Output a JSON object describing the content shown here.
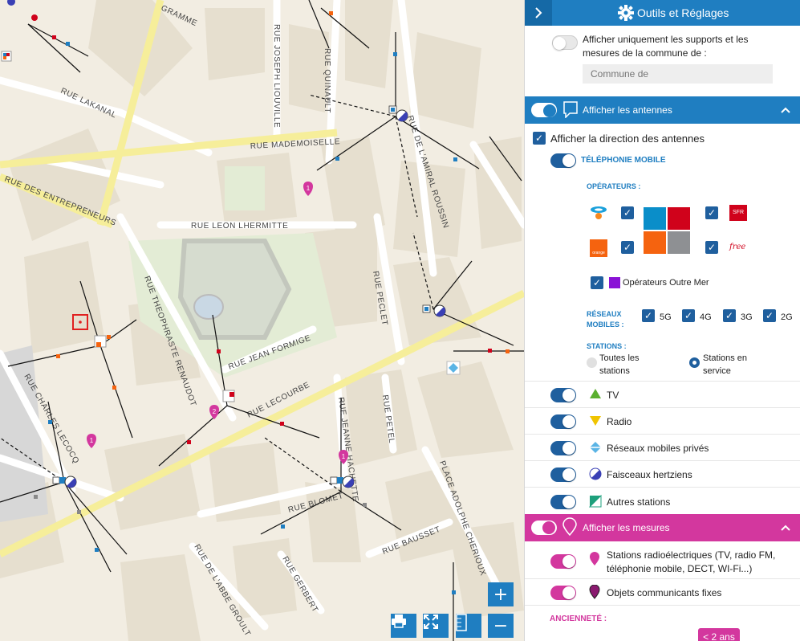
{
  "map": {
    "streets": [
      "RUE LAKANAL",
      "RUE JOSEPH LIOUVILLE",
      "RUE QUINAULT",
      "RUE MADEMOISELLE",
      "RUE DES ENTREPRENEURS",
      "RUE DE L'AMIRAL ROUSSIN",
      "RUE LEON LHERMITTE",
      "RUE THEOPHRASTE RENAUDOT",
      "RUE PECLET",
      "RUE JEAN FORMIGE",
      "RUE CHARLES LECOCQ",
      "RUE LECOURBE",
      "RUE JEANNE HACHETTE",
      "RUE PETEL",
      "PLACE ADOLPHE CHERIOUX",
      "RUE BLOMET",
      "RUE BAUSSET",
      "RUE DE L'ABBE GROULT",
      "RUE GERBERT",
      "GRAMME"
    ],
    "pins": [
      "1",
      "2",
      "1",
      "1"
    ],
    "zoom_in": "+",
    "zoom_out": "−"
  },
  "panel": {
    "header_title": "Outils et Réglages",
    "commune_only_label": "Afficher uniquement les supports et les mesures de la commune de :",
    "commune_placeholder": "Commune de",
    "antennas_section": "Afficher les antennes",
    "show_direction": "Afficher la direction des antennes",
    "mobile_phone": "TÉLÉPHONIE MOBILE",
    "operators_label": "OPÉRATEURS :",
    "operators": {
      "bouygues": "",
      "sfr": "SFR",
      "orange": "orange",
      "free": "free"
    },
    "overseas": "Opérateurs Outre Mer",
    "networks_label": "RÉSEAUX MOBILES :",
    "networks": [
      "5G",
      "4G",
      "3G",
      "2G"
    ],
    "stations_label": "STATIONS :",
    "stations_all": "Toutes les stations",
    "stations_service": "Stations en service",
    "layers": [
      "TV",
      "Radio",
      "Réseaux mobiles privés",
      "Faisceaux hertziens",
      "Autres stations"
    ],
    "measures_section": "Afficher les mesures",
    "measure_items": [
      "Stations radioélectriques (TV, radio FM, téléphonie mobile, DECT, WI-Fi...)",
      "Objets communicants fixes"
    ],
    "age_label": "ANCIENNETÉ :",
    "age_value": "< 2 ans"
  },
  "colors": {
    "accent": "#1f7ec1",
    "dark_accent": "#1f5f9e",
    "measures": "#d3379e",
    "pin": "#d3379e"
  }
}
